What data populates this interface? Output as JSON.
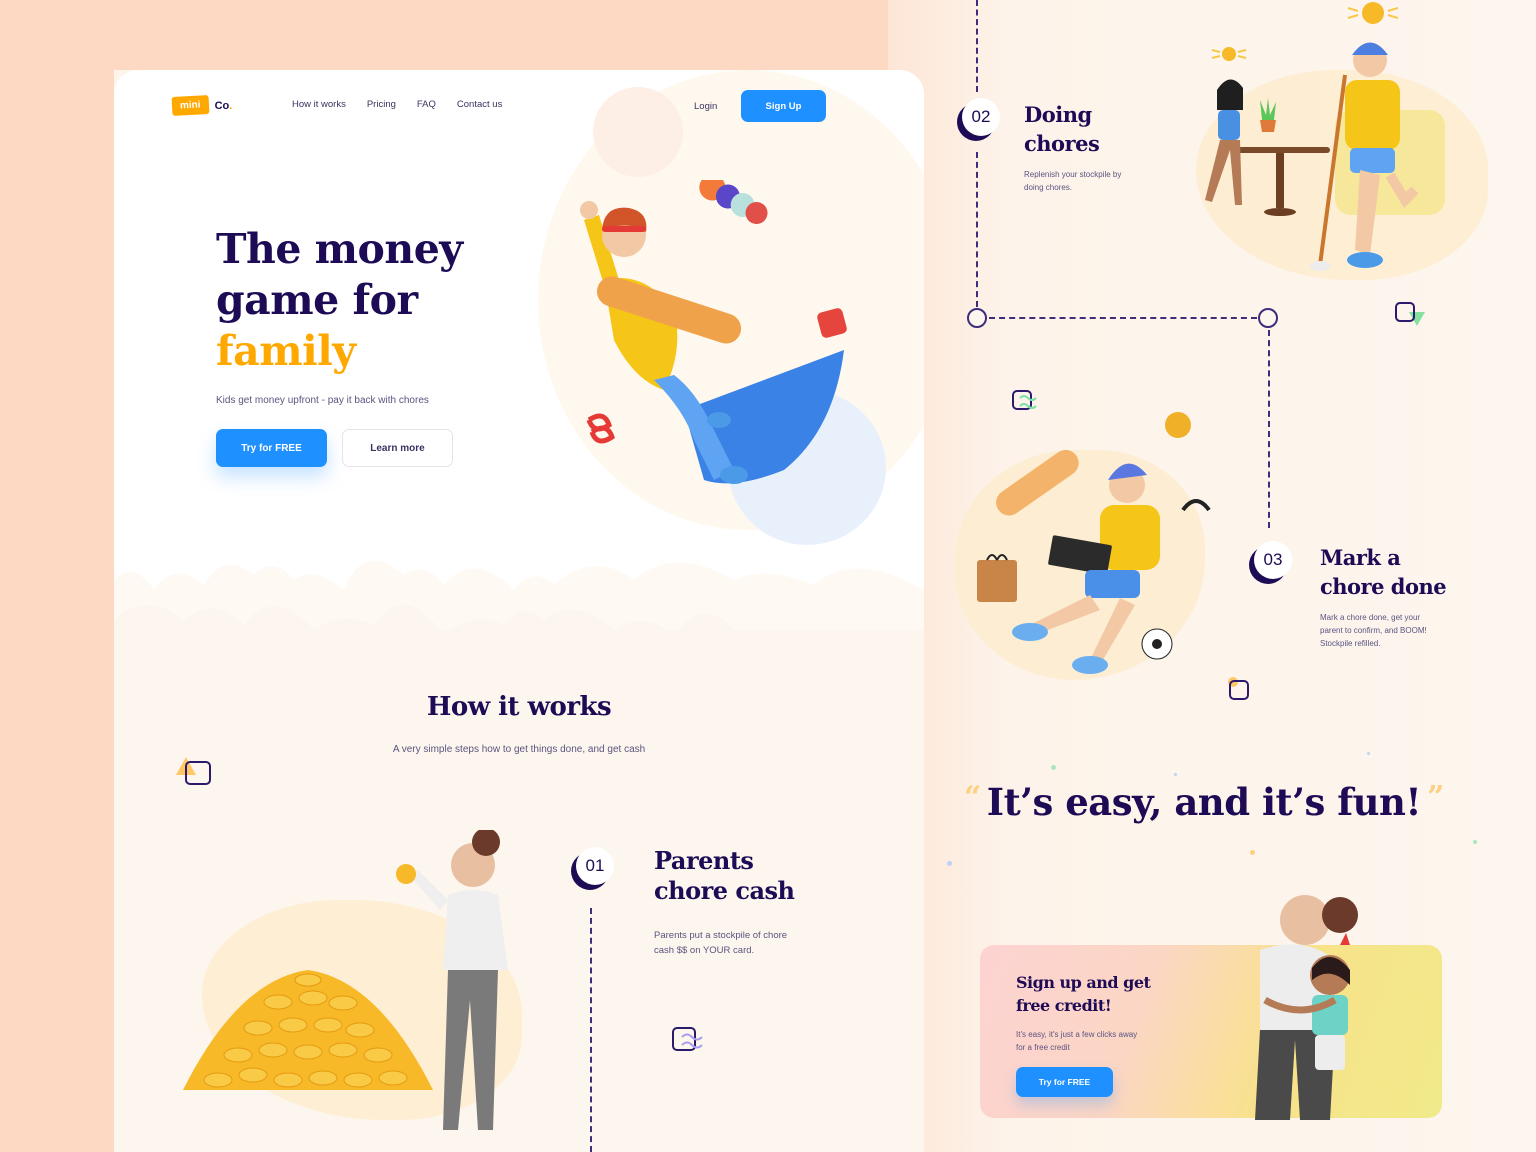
{
  "header": {
    "logo_badge": "mini",
    "logo_text": "Co",
    "logo_dot": ".",
    "nav": [
      "How it works",
      "Pricing",
      "FAQ",
      "Contact us"
    ],
    "login_label": "Login",
    "signup_label": "Sign Up"
  },
  "hero": {
    "title_line1": "The money",
    "title_line2": "game for",
    "title_accent": "family",
    "subtitle": "Kids get money upfront - pay it back with chores",
    "primary_button": "Try for FREE",
    "secondary_button": "Learn more"
  },
  "how_it_works": {
    "title": "How it works",
    "subtitle": "A very simple steps how to get things done, and get cash",
    "steps": [
      {
        "number": "01",
        "title_line1": "Parents",
        "title_line2": "chore cash",
        "desc_line1": "Parents put a stockpile of chore",
        "desc_line2": "cash $$ on YOUR card."
      },
      {
        "number": "02",
        "title_line1": "Doing",
        "title_line2": "chores",
        "desc_line1": "Replenish your stockpile by",
        "desc_line2": "doing chores."
      },
      {
        "number": "03",
        "title_line1": "Mark a",
        "title_line2": "chore done",
        "desc_line1": "Mark a chore done, get your",
        "desc_line2": "parent to confirm, and BOOM!",
        "desc_line3": "Stockpile refilled."
      }
    ]
  },
  "quote": {
    "open_mark": "“",
    "text": "It’s easy, and it’s fun!",
    "close_mark": "”"
  },
  "cta": {
    "title_line1": "Sign up and get",
    "title_line2": "free credit!",
    "desc_line1": "It's easy, it's just a few clicks away",
    "desc_line2": "for a free credit",
    "button": "Try for FREE"
  },
  "colors": {
    "primary": "#1e90ff",
    "accent": "#ffa800",
    "navy": "#1e0b55",
    "peach": "#fdd9c3"
  }
}
